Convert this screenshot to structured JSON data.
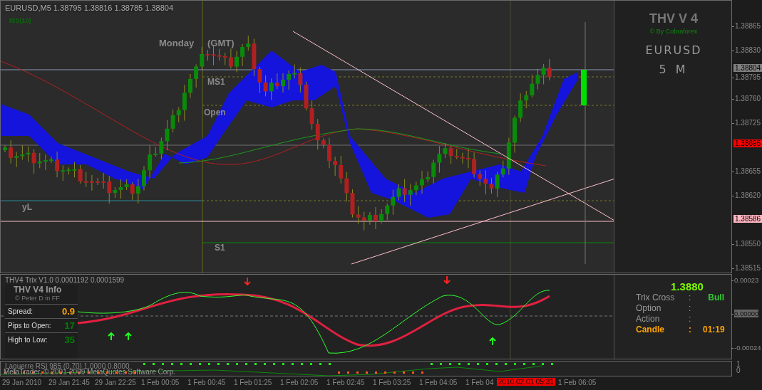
{
  "chart": {
    "symbol_info": "EURUSD,M5  1.38795 1.38816 1.38785 1.38804",
    "indicator_tag": "ISS(10)",
    "labels": [
      {
        "text": "Monday",
        "kind": "session"
      },
      {
        "text": "(GMT)",
        "kind": "session"
      },
      {
        "text": "MS1",
        "kind": "level"
      },
      {
        "text": "Open",
        "kind": "level"
      },
      {
        "text": "yL",
        "kind": "level"
      },
      {
        "text": "S1",
        "kind": "level"
      }
    ],
    "brand": {
      "title": "THV V 4",
      "credit": "© By Cobraforex",
      "symbol": "EURUSD",
      "timeframe": "5 M"
    },
    "price_axis": [
      "1.38865",
      "1.38830",
      "1.38795",
      "1.38760",
      "1.38725",
      "1.38655",
      "1.38620",
      "1.38550",
      "1.38515"
    ],
    "price_markers": [
      {
        "text": "1.38804",
        "color": "#808080"
      },
      {
        "text": "1.38695",
        "color": "#ff0000"
      },
      {
        "text": "1.38586",
        "color": "#ffb6c1"
      }
    ]
  },
  "trix_panel": {
    "title": "THV4 Trix V1.0 0.0001192 0.0001599",
    "info": {
      "title": "THV  V4  Info",
      "credit": "© Peter D in FF",
      "rows": [
        {
          "label": "Spread:",
          "value": "0.9",
          "color": "#ffa500"
        },
        {
          "label": "Pips to Open:",
          "value": "17",
          "color": "#008000"
        },
        {
          "label": "High to Low:",
          "value": "35",
          "color": "#008000"
        }
      ]
    },
    "status": {
      "price": "1.3880",
      "rows": [
        {
          "label": "Trix Cross",
          "sep": ":",
          "value": "Bull",
          "kind": "plain"
        },
        {
          "label": "Option",
          "sep": ":",
          "kind": "plain"
        },
        {
          "label": "Action",
          "sep": ":",
          "kind": "plain"
        },
        {
          "label": "Candle",
          "sep": ":",
          "value": "01:19",
          "kind": "highlight"
        }
      ]
    },
    "axis": [
      "0.00023",
      "0.00000",
      "-0.00024"
    ]
  },
  "laguerre_panel": {
    "title": "Laguerre RSI 985 (0.70) 1.0000 0.8000",
    "copyright": "MetaTrader, © 2001-2009 MetaQuotes Software Corp.",
    "axis": [
      "1",
      "0"
    ]
  },
  "time_axis": {
    "labels": [
      "29 Jan 2010",
      "29 Jan 21:45",
      "29 Jan 22:25",
      "1 Feb 00:05",
      "1 Feb 00:45",
      "1 Feb 01:25",
      "1 Feb 02:05",
      "1 Feb 02:45",
      "1 Feb 03:25",
      "1 Feb 04:05",
      "1 Feb 04",
      "1 Feb 06:05"
    ],
    "cursor_label": "2010.02.01 05:31"
  }
}
